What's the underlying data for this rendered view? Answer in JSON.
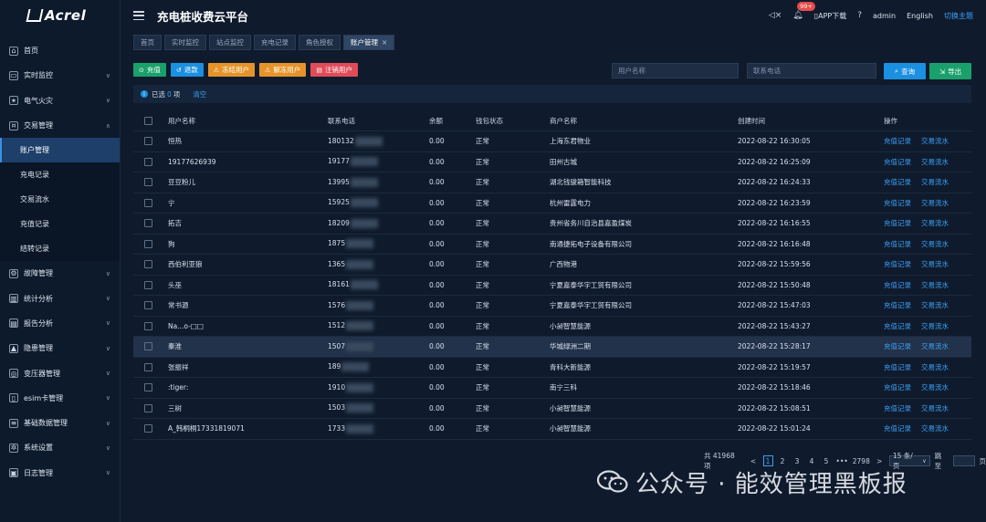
{
  "brand": "Acrel",
  "app_title": "充电桩收费云平台",
  "header": {
    "notif_count": "99+",
    "app_download": "APP下载",
    "user": "admin",
    "language": "English",
    "theme_switch": "切换主题"
  },
  "sidebar": {
    "items": [
      {
        "label": "首页",
        "icon": "home-icon"
      },
      {
        "label": "实时监控",
        "icon": "monitor-icon"
      },
      {
        "label": "电气火灾",
        "icon": "fire-icon"
      },
      {
        "label": "交易管理",
        "icon": "transaction-icon",
        "expanded": true
      }
    ],
    "sub_items": [
      "账户管理",
      "充电记录",
      "交易流水",
      "充值记录",
      "结转记录"
    ],
    "active_sub": "账户管理",
    "items_after": [
      {
        "label": "故障管理",
        "icon": "fault-icon"
      },
      {
        "label": "统计分析",
        "icon": "stats-icon"
      },
      {
        "label": "报告分析",
        "icon": "report-icon"
      },
      {
        "label": "隐患管理",
        "icon": "hazard-icon"
      },
      {
        "label": "变压器管理",
        "icon": "transformer-icon"
      },
      {
        "label": "esim卡管理",
        "icon": "sim-icon"
      },
      {
        "label": "基础数据管理",
        "icon": "database-icon"
      },
      {
        "label": "系统设置",
        "icon": "settings-icon"
      },
      {
        "label": "日志管理",
        "icon": "log-icon"
      }
    ]
  },
  "tabs": [
    "首页",
    "实时监控",
    "站点监控",
    "充电记录",
    "角色授权",
    "账户管理"
  ],
  "active_tab": "账户管理",
  "toolbar": {
    "recharge": "充值",
    "refund": "退款",
    "freeze": "冻结用户",
    "unfreeze": "解冻用户",
    "cancel": "注销用户"
  },
  "search": {
    "name_placeholder": "用户名称",
    "phone_placeholder": "联系电话",
    "query": "查询",
    "export": "导出"
  },
  "selection": {
    "prefix": "已选",
    "count": "0",
    "suffix": "项",
    "clear": "清空"
  },
  "table": {
    "columns": [
      "用户名称",
      "联系电话",
      "余额",
      "钱包状态",
      "商户名称",
      "创建时间",
      "操作"
    ],
    "op_recharge": "充值记录",
    "op_flow": "交易流水",
    "rows": [
      {
        "name": "恒热",
        "phone": "180132",
        "balance": "0.00",
        "status": "正常",
        "merchant": "上海东君物业",
        "time": "2022-08-22 16:30:05"
      },
      {
        "name": "19177626939",
        "phone": "19177",
        "balance": "0.00",
        "status": "正常",
        "merchant": "田州古城",
        "time": "2022-08-22 16:25:09"
      },
      {
        "name": "豆豆粉儿",
        "phone": "13995",
        "balance": "0.00",
        "status": "正常",
        "merchant": "湖北钱骏箱智能科技",
        "time": "2022-08-22 16:24:33"
      },
      {
        "name": "宁",
        "phone": "15925",
        "balance": "0.00",
        "status": "正常",
        "merchant": "杭州雷霆电力",
        "time": "2022-08-22 16:23:59"
      },
      {
        "name": "拓吉",
        "phone": "18209",
        "balance": "0.00",
        "status": "正常",
        "merchant": "贵州省务川自治县嘉盈煤炭",
        "time": "2022-08-22 16:16:55"
      },
      {
        "name": "狗",
        "phone": "1875",
        "balance": "0.00",
        "status": "正常",
        "merchant": "南通捷拓电子设备有限公司",
        "time": "2022-08-22 16:16:48"
      },
      {
        "name": "西伯利亚狼",
        "phone": "1365",
        "balance": "0.00",
        "status": "正常",
        "merchant": "广西物港",
        "time": "2022-08-22 15:59:56"
      },
      {
        "name": "头巫",
        "phone": "18161",
        "balance": "0.00",
        "status": "正常",
        "merchant": "宁夏嘉泰华宇工贸有限公司",
        "time": "2022-08-22 15:50:48"
      },
      {
        "name": "常书源",
        "phone": "1576",
        "balance": "0.00",
        "status": "正常",
        "merchant": "宁夏嘉泰华宇工贸有限公司",
        "time": "2022-08-22 15:47:03"
      },
      {
        "name": "Na...o-□□",
        "phone": "1512",
        "balance": "0.00",
        "status": "正常",
        "merchant": "小昶智慧能源",
        "time": "2022-08-22 15:43:27"
      },
      {
        "name": "秦淮",
        "phone": "1507",
        "balance": "0.00",
        "status": "正常",
        "merchant": "华城绿洲二期",
        "time": "2022-08-22 15:28:17"
      },
      {
        "name": "张振祥",
        "phone": "189",
        "balance": "0.00",
        "status": "正常",
        "merchant": "青科大新能源",
        "time": "2022-08-22 15:19:57"
      },
      {
        "name": ":tiger:",
        "phone": "1910",
        "balance": "0.00",
        "status": "正常",
        "merchant": "南宁三科",
        "time": "2022-08-22 15:18:46"
      },
      {
        "name": "三树",
        "phone": "1503",
        "balance": "0.00",
        "status": "正常",
        "merchant": "小昶智慧能源",
        "time": "2022-08-22 15:08:51"
      },
      {
        "name": "A_韩桐桐17331819071",
        "phone": "1733",
        "balance": "0.00",
        "status": "正常",
        "merchant": "小昶智慧能源",
        "time": "2022-08-22 15:01:24"
      }
    ]
  },
  "pagination": {
    "total": "共 41968 项",
    "prev": "<",
    "pages": [
      "1",
      "2",
      "3",
      "4",
      "5"
    ],
    "ellipsis": "•••",
    "last": "2798",
    "next": ">",
    "page_size": "15 条/页",
    "goto": "跳至",
    "page_unit": "页"
  },
  "watermark": "公众号 · 能效管理黑板报",
  "colors": {
    "accent": "#1b8fe0",
    "link": "#3da0f5",
    "green": "#1aa06b",
    "orange": "#e6942a",
    "red": "#e04b5a"
  }
}
